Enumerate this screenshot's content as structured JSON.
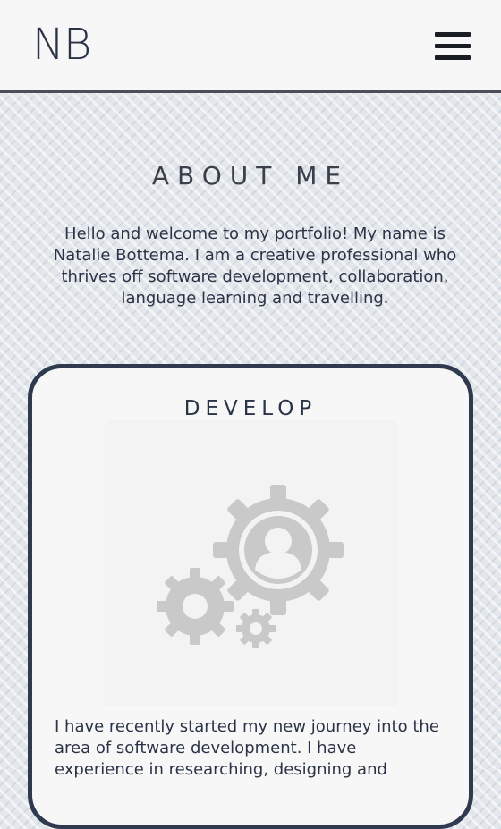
{
  "header": {
    "logo": "NB",
    "menu_icon": "hamburger-menu-icon"
  },
  "about": {
    "title": "ABOUT ME",
    "intro": "Hello and welcome to my portfolio! My name is Natalie Bottema. I am a creative professional who thrives off software development, collaboration, language learning and travelling."
  },
  "card": {
    "title": "DEVELOP",
    "illustration_icon": "gears-person-icon",
    "text": "I have recently started my new journey into the area of software development. I have experience in researching, designing and"
  },
  "colors": {
    "text": "#2b3446",
    "card_border": "#2f3a4e",
    "header_bg": "#f7f7f7",
    "illustration_gray": "#c8c8c8"
  }
}
